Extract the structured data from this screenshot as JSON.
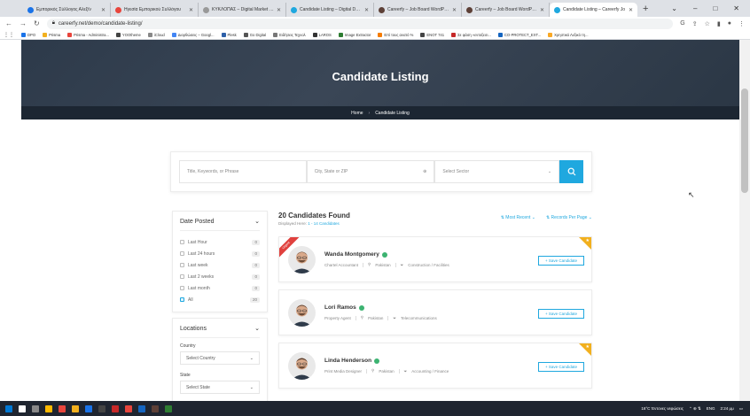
{
  "browser": {
    "tabs": [
      {
        "title": "Εμπορικός Σύλλογος Αλεξ/ν",
        "color": "#1a73e8"
      },
      {
        "title": "Ηγεσία Εμπορικού Συλλόγου",
        "color": "#e8453c"
      },
      {
        "title": "ΚΥΚΛΟΠΑΣ – Digital Market Plac",
        "color": "#999999"
      },
      {
        "title": "Candidate Listing – Digital Data",
        "color": "#1fa8df"
      },
      {
        "title": "Careerfy – Job Board WordPress",
        "color": "#5d4037"
      },
      {
        "title": "Careerfy – Job Board WordPress",
        "color": "#5d4037"
      },
      {
        "title": "Candidate Listing – Careerfy Jo",
        "color": "#1fa8df",
        "active": true
      }
    ],
    "new_tab": "+",
    "url": "careerfy.net/demo/candidate-listing/",
    "bookmarks": [
      {
        "label": "DPO",
        "color": "#1a73e8"
      },
      {
        "label": "Prisma",
        "color": "#f2b01e"
      },
      {
        "label": "Prisma - Administra...",
        "color": "#e8453c"
      },
      {
        "label": "YOOtheme",
        "color": "#444444"
      },
      {
        "label": "iCloud",
        "color": "#888888"
      },
      {
        "label": "Διορθώσεις – Googl...",
        "color": "#4285f4"
      },
      {
        "label": "Plesk",
        "color": "#2c5fa8"
      },
      {
        "label": "Go Digital",
        "color": "#555555"
      },
      {
        "label": "Ειδήσεις Τεχνολ",
        "color": "#777777"
      },
      {
        "label": "LAROS",
        "color": "#333333"
      },
      {
        "label": "Image Extractor",
        "color": "#2e7d32"
      },
      {
        "label": "Επί τους ανατό %",
        "color": "#f57c00"
      },
      {
        "label": "ΕΝΟΤ 741",
        "color": "#444444"
      },
      {
        "label": "Σε φάση «εντοξεσι...",
        "color": "#c62828"
      },
      {
        "label": "CO-PROTECT_EXT...",
        "color": "#1565c0"
      },
      {
        "label": "Χρηστικό Λεξικό τη...",
        "color": "#f9a825"
      }
    ]
  },
  "hero": {
    "title": "Candidate Listing"
  },
  "breadcrumb": {
    "home": "Home",
    "separator": "›",
    "current": "Candidate Listing"
  },
  "search": {
    "keyword_placeholder": "Title, Keywords, or Phrase",
    "city_placeholder": "City, State or ZIP",
    "sector_placeholder": "Select Sector"
  },
  "filters": {
    "date_posted": {
      "title": "Date Posted",
      "options": [
        {
          "label": "Last Hour",
          "count": "0",
          "checked": false
        },
        {
          "label": "Last 24 hours",
          "count": "0",
          "checked": false
        },
        {
          "label": "Last week",
          "count": "0",
          "checked": false
        },
        {
          "label": "Last 2 weeks",
          "count": "0",
          "checked": false
        },
        {
          "label": "Last month",
          "count": "0",
          "checked": false
        },
        {
          "label": "All",
          "count": "20",
          "checked": true
        }
      ]
    },
    "locations": {
      "title": "Locations",
      "country_label": "Country",
      "country_value": "Select Country",
      "state_label": "State",
      "state_value": "Select State"
    }
  },
  "results": {
    "title": "20 Candidates Found",
    "subtitle_prefix": "Displayed Here:",
    "subtitle_range": "1 - 14 Candidates",
    "sort_label": "Most Recent",
    "per_page_label": "Records Per Page",
    "save_label": "+ Save Candidate",
    "featured_label": "Urgent",
    "candidates": [
      {
        "name": "Wanda Montgomery",
        "role": "Chartel Accountant",
        "location": "Pakistan",
        "sector": "Construction / Facilities",
        "featured": true,
        "ribbon": true
      },
      {
        "name": "Lori Ramos",
        "role": "Property Agent",
        "location": "Pakistan",
        "sector": "Telecommunications",
        "featured": false,
        "ribbon": false
      },
      {
        "name": "Linda Henderson",
        "role": "Print Media Designer",
        "location": "Pakistan",
        "sector": "Accounting / Finance",
        "featured": true,
        "ribbon": false
      }
    ]
  },
  "taskbar": {
    "weather": "16°C Έντονες νεφώσεις",
    "lang": "ENG",
    "time": "2:24 μμ"
  },
  "colors": {
    "accent": "#1fa8df",
    "featured": "#f2b01e",
    "ribbon": "#e0413e",
    "hero": "#2d3a4a"
  }
}
